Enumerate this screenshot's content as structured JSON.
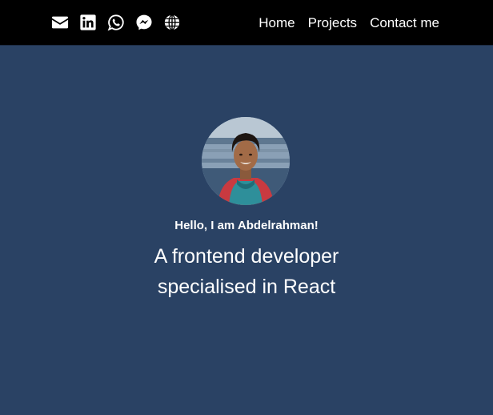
{
  "nav": {
    "socials": [
      {
        "icon": "mail-icon"
      },
      {
        "icon": "linkedin-icon"
      },
      {
        "icon": "whatsapp-icon"
      },
      {
        "icon": "messenger-icon"
      },
      {
        "icon": "globe-icon"
      }
    ],
    "links": [
      "Home",
      "Projects",
      "Contact me"
    ]
  },
  "hero": {
    "greeting": "Hello, I am Abdelrahman!",
    "tagline": "A frontend developer specialised in React"
  },
  "colors": {
    "navbar_bg": "#000000",
    "page_bg": "#2a4264",
    "text": "#ffffff"
  }
}
